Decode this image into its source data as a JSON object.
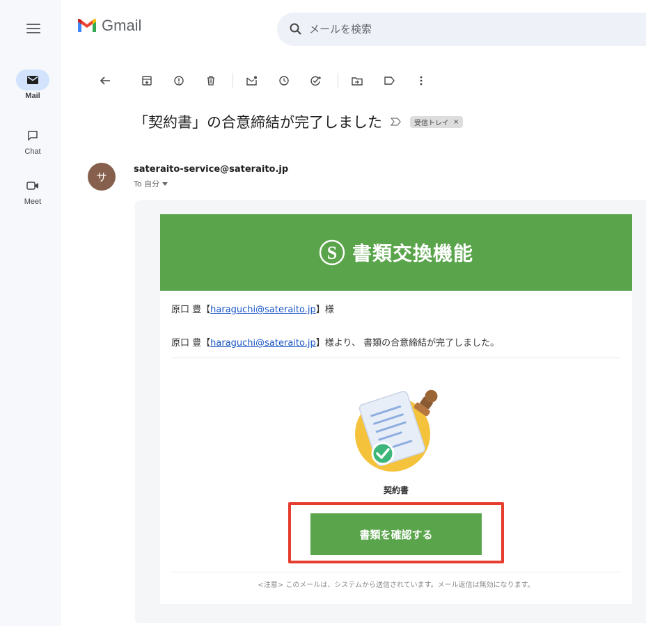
{
  "rail": {
    "items": [
      {
        "label": "Mail",
        "icon": "mail-icon",
        "active": true
      },
      {
        "label": "Chat",
        "icon": "chat-icon",
        "active": false
      },
      {
        "label": "Meet",
        "icon": "meet-icon",
        "active": false
      }
    ]
  },
  "header": {
    "brand": "Gmail",
    "search_placeholder": "メールを検索"
  },
  "toolbar": {
    "icons": [
      "back-icon",
      "archive-icon",
      "report-spam-icon",
      "delete-icon",
      "mark-unread-icon",
      "snooze-icon",
      "add-to-tasks-icon",
      "move-to-icon",
      "labels-icon",
      "more-icon"
    ]
  },
  "message": {
    "subject": "「契約書」の合意締結が完了しました",
    "label_chip": "受信トレイ",
    "avatar_letter": "サ",
    "sender": "sateraito-service@sateraito.jp",
    "recipient": "To 自分"
  },
  "email": {
    "banner_logo_letter": "S",
    "banner_title": "書類交換機能",
    "greeting_name": "原口 豊【",
    "greeting_link": "haraguchi@sateraito.jp",
    "greeting_suffix": "】様",
    "body_name": "原口 豊【",
    "body_link": "haraguchi@sateraito.jp",
    "body_suffix": "】様より、 書類の合意締結が完了しました。",
    "document_name": "契約書",
    "button_label": "書類を確認する",
    "footer_note": "<注意> このメールは、システムから送信されています。メール返信は無効になります。"
  },
  "colors": {
    "banner_green": "#5aa44b",
    "highlight_red": "#e53d2e",
    "link_blue": "#1a56c4",
    "avatar_brown": "#86604d"
  }
}
